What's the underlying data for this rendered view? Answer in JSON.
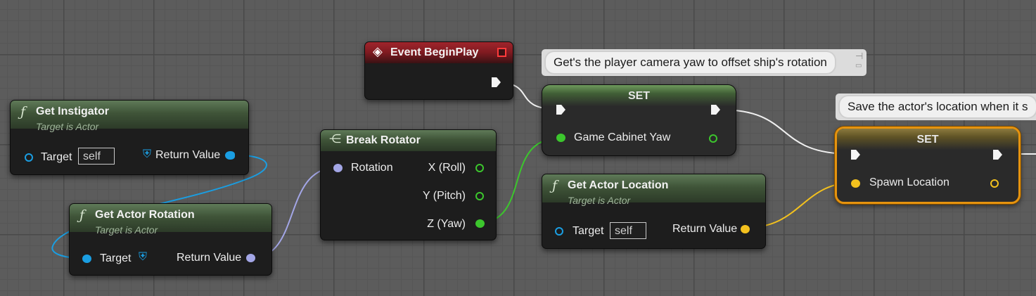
{
  "colors": {
    "background": "#5c5c5c",
    "function_header": "#3f5438",
    "event_header": "#7e1a20",
    "exec_pin": "#f4f4f4",
    "object_pin": "#1a9ee2",
    "rotator_pin": "#a3a6e6",
    "float_pin": "#3cc62d",
    "vector_pin": "#f3c11e",
    "selection_outline": "#e5930f"
  },
  "nodes": {
    "get_instigator": {
      "title": "Get Instigator",
      "subtitle": "Target is Actor",
      "target_label": "Target",
      "target_value": "self",
      "return_label": "Return Value"
    },
    "get_actor_rotation": {
      "title": "Get Actor Rotation",
      "subtitle": "Target is Actor",
      "target_label": "Target",
      "return_label": "Return Value"
    },
    "break_rotator": {
      "title": "Break Rotator",
      "input_label": "Rotation",
      "outputs": [
        "X (Roll)",
        "Y (Pitch)",
        "Z (Yaw)"
      ]
    },
    "event_begin_play": {
      "title": "Event BeginPlay"
    },
    "set_yaw": {
      "title": "SET",
      "variable_label": "Game Cabinet Yaw",
      "comment": "Get's the player camera yaw to offset ship's rotation"
    },
    "get_actor_location": {
      "title": "Get Actor Location",
      "subtitle": "Target is Actor",
      "target_label": "Target",
      "target_value": "self",
      "return_label": "Return Value"
    },
    "set_location": {
      "title": "SET",
      "variable_label": "Spawn Location",
      "comment": "Save the actor's location when it s"
    }
  },
  "icons": {
    "function": "function-icon",
    "event": "event-diamond-icon",
    "break": "break-struct-icon",
    "pin_comment": "pin-icon"
  }
}
